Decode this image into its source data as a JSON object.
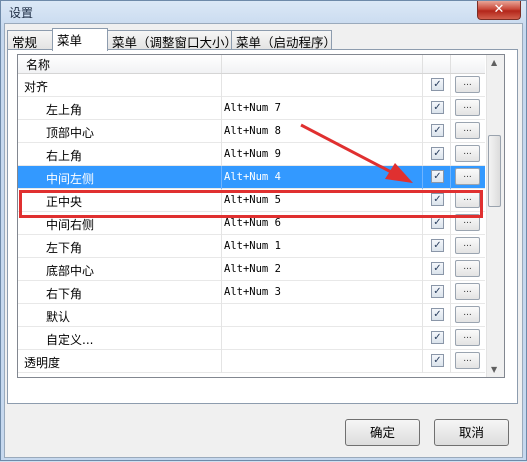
{
  "window": {
    "title": "设置",
    "close_label": "✕"
  },
  "tabs": [
    {
      "label": "常规"
    },
    {
      "label": "菜单"
    },
    {
      "label": "菜单（调整窗口大小）"
    },
    {
      "label": "菜单（启动程序）"
    }
  ],
  "list": {
    "header_name": "名称",
    "rows": [
      {
        "name": "对齐",
        "shortcut": "",
        "checked": true
      },
      {
        "name": "左上角",
        "shortcut": "Alt+Num 7",
        "checked": true
      },
      {
        "name": "顶部中心",
        "shortcut": "Alt+Num 8",
        "checked": true
      },
      {
        "name": "右上角",
        "shortcut": "Alt+Num 9",
        "checked": true
      },
      {
        "name": "中间左侧",
        "shortcut": "Alt+Num 4",
        "checked": true,
        "selected": true
      },
      {
        "name": "正中央",
        "shortcut": "Alt+Num 5",
        "checked": true
      },
      {
        "name": "中间右侧",
        "shortcut": "Alt+Num 6",
        "checked": true
      },
      {
        "name": "左下角",
        "shortcut": "Alt+Num 1",
        "checked": true
      },
      {
        "name": "底部中心",
        "shortcut": "Alt+Num 2",
        "checked": true
      },
      {
        "name": "右下角",
        "shortcut": "Alt+Num 3",
        "checked": true
      },
      {
        "name": "默认",
        "shortcut": "",
        "checked": true
      },
      {
        "name": "自定义...",
        "shortcut": "",
        "checked": true
      },
      {
        "name": "透明度",
        "shortcut": "",
        "checked": true
      }
    ],
    "button_label": "...",
    "check_glyph": "✓"
  },
  "footer": {
    "ok_label": "确定",
    "cancel_label": "取消"
  },
  "colors": {
    "selection": "#3399ff",
    "annotation": "#e03030"
  }
}
